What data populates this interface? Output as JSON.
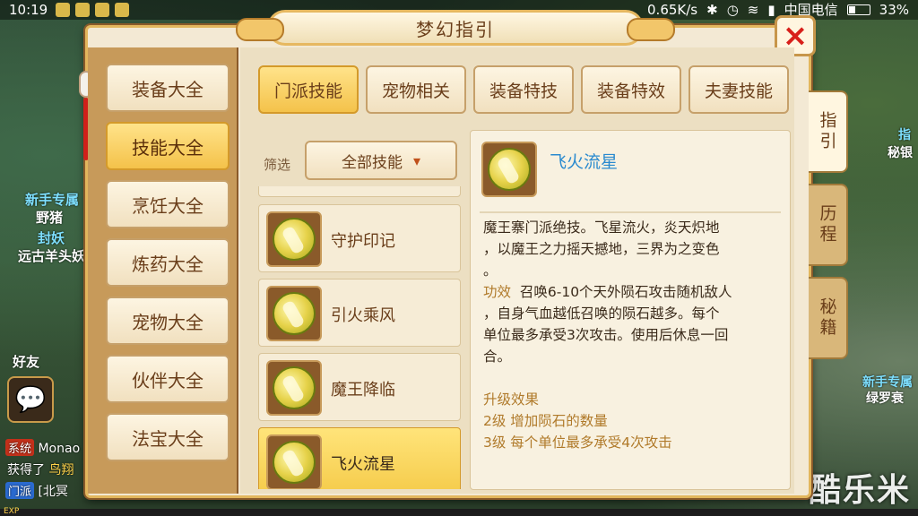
{
  "statusbar": {
    "time": "10:19",
    "net_speed": "0.65K/s",
    "carrier": "中国电信",
    "battery": "33%"
  },
  "background": {
    "left_npc_1": "新手专属",
    "left_npc_1b": "野猪",
    "left_npc_2": "封妖",
    "left_npc_2b": "远古羊头妖",
    "friend_label": "好友",
    "chat_1_tag": "系统",
    "chat_1_text": "Monao",
    "chat_2_text": "获得了",
    "chat_2_highlight": "鸟翔",
    "chat_3_tag": "门派",
    "chat_3_text": "[北冥",
    "exp_label": "EXP",
    "right_npc_1": "指",
    "right_npc_1b": "秘银",
    "right_npc_2": "新手专属",
    "right_npc_2b": "绿罗衰",
    "watermark": "酷乐米"
  },
  "dialog": {
    "title": "梦幻指引",
    "close_label": "×",
    "left_menu": [
      {
        "label": "装备大全"
      },
      {
        "label": "技能大全"
      },
      {
        "label": "烹饪大全"
      },
      {
        "label": "炼药大全"
      },
      {
        "label": "宠物大全"
      },
      {
        "label": "伙伴大全"
      },
      {
        "label": "法宝大全"
      }
    ],
    "active_left": "技能大全",
    "tabs": [
      {
        "label": "门派技能"
      },
      {
        "label": "宠物相关"
      },
      {
        "label": "装备特技"
      },
      {
        "label": "装备特效"
      },
      {
        "label": "夫妻技能"
      }
    ],
    "active_tab": "门派技能",
    "filter": {
      "label": "筛选",
      "value": "全部技能"
    },
    "skills": [
      {
        "name": "守护印记"
      },
      {
        "name": "引火乘风"
      },
      {
        "name": "魔王降临"
      },
      {
        "name": "飞火流星"
      }
    ],
    "selected_skill": "飞火流星",
    "detail": {
      "name": "飞火流星",
      "desc_line1": "魔王寨门派绝技。飞星流火，炎天炽地",
      "desc_line2": "，以魔王之力摇天撼地，三界为之变色",
      "desc_line3": "。",
      "effect_kw": "功效",
      "effect_line1": "召唤6-10个天外陨石攻击随机敌人",
      "effect_line2": "，自身气血越低召唤的陨石越多。每个",
      "effect_line3": "单位最多承受3次攻击。使用后休息一回",
      "effect_line4": "合。",
      "upgrade_title": "升级效果",
      "upgrade_1": "2级  增加陨石的数量",
      "upgrade_2": "3级  每个单位最多承受4次攻击"
    },
    "side_tabs": [
      {
        "label": "指引"
      },
      {
        "label": "历程"
      },
      {
        "label": "秘籍"
      }
    ],
    "active_side_tab": "指引"
  }
}
